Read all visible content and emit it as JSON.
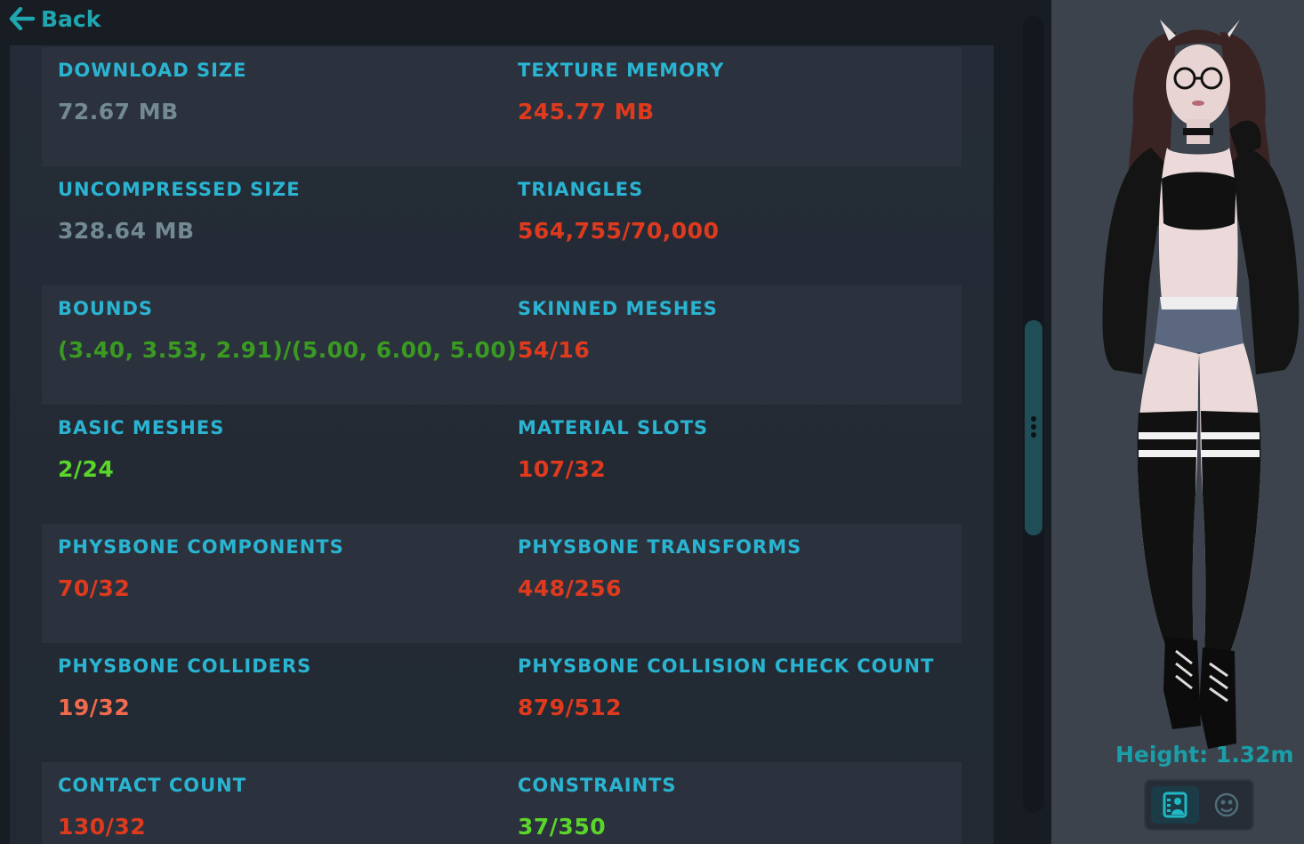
{
  "nav": {
    "back_label": "Back"
  },
  "colors": {
    "label": "#2ab4d1",
    "neutral": "#738a92",
    "poor": "#e03a1e",
    "medium": "#f06a4e",
    "good": "#5ad62a",
    "excellent": "#3a9a22",
    "accent": "#1fa6ae"
  },
  "stats": [
    [
      {
        "label": "DOWNLOAD SIZE",
        "value": "72.67 MB",
        "status": "neutral"
      },
      {
        "label": "TEXTURE MEMORY",
        "value": "245.77 MB",
        "status": "poor"
      }
    ],
    [
      {
        "label": "UNCOMPRESSED SIZE",
        "value": "328.64 MB",
        "status": "neutral"
      },
      {
        "label": "TRIANGLES",
        "value": "564,755/70,000",
        "status": "poor"
      }
    ],
    [
      {
        "label": "BOUNDS",
        "value": "(3.40, 3.53, 2.91)/(5.00, 6.00, 5.00)",
        "status": "excellent"
      },
      {
        "label": "SKINNED MESHES",
        "value": "54/16",
        "status": "poor"
      }
    ],
    [
      {
        "label": "BASIC MESHES",
        "value": "2/24",
        "status": "good"
      },
      {
        "label": "MATERIAL SLOTS",
        "value": "107/32",
        "status": "poor"
      }
    ],
    [
      {
        "label": "PHYSBONE COMPONENTS",
        "value": "70/32",
        "status": "poor"
      },
      {
        "label": "PHYSBONE TRANSFORMS",
        "value": "448/256",
        "status": "poor"
      }
    ],
    [
      {
        "label": "PHYSBONE COLLIDERS",
        "value": "19/32",
        "status": "medium"
      },
      {
        "label": "PHYSBONE COLLISION CHECK COUNT",
        "value": "879/512",
        "status": "poor"
      }
    ],
    [
      {
        "label": "CONTACT COUNT",
        "value": "130/32",
        "status": "poor"
      },
      {
        "label": "CONSTRAINTS",
        "value": "37/350",
        "status": "good"
      }
    ]
  ],
  "avatar": {
    "height_label": "Height: 1.32m",
    "icons": [
      "avatar-card-icon",
      "avatar-mask-icon"
    ]
  }
}
